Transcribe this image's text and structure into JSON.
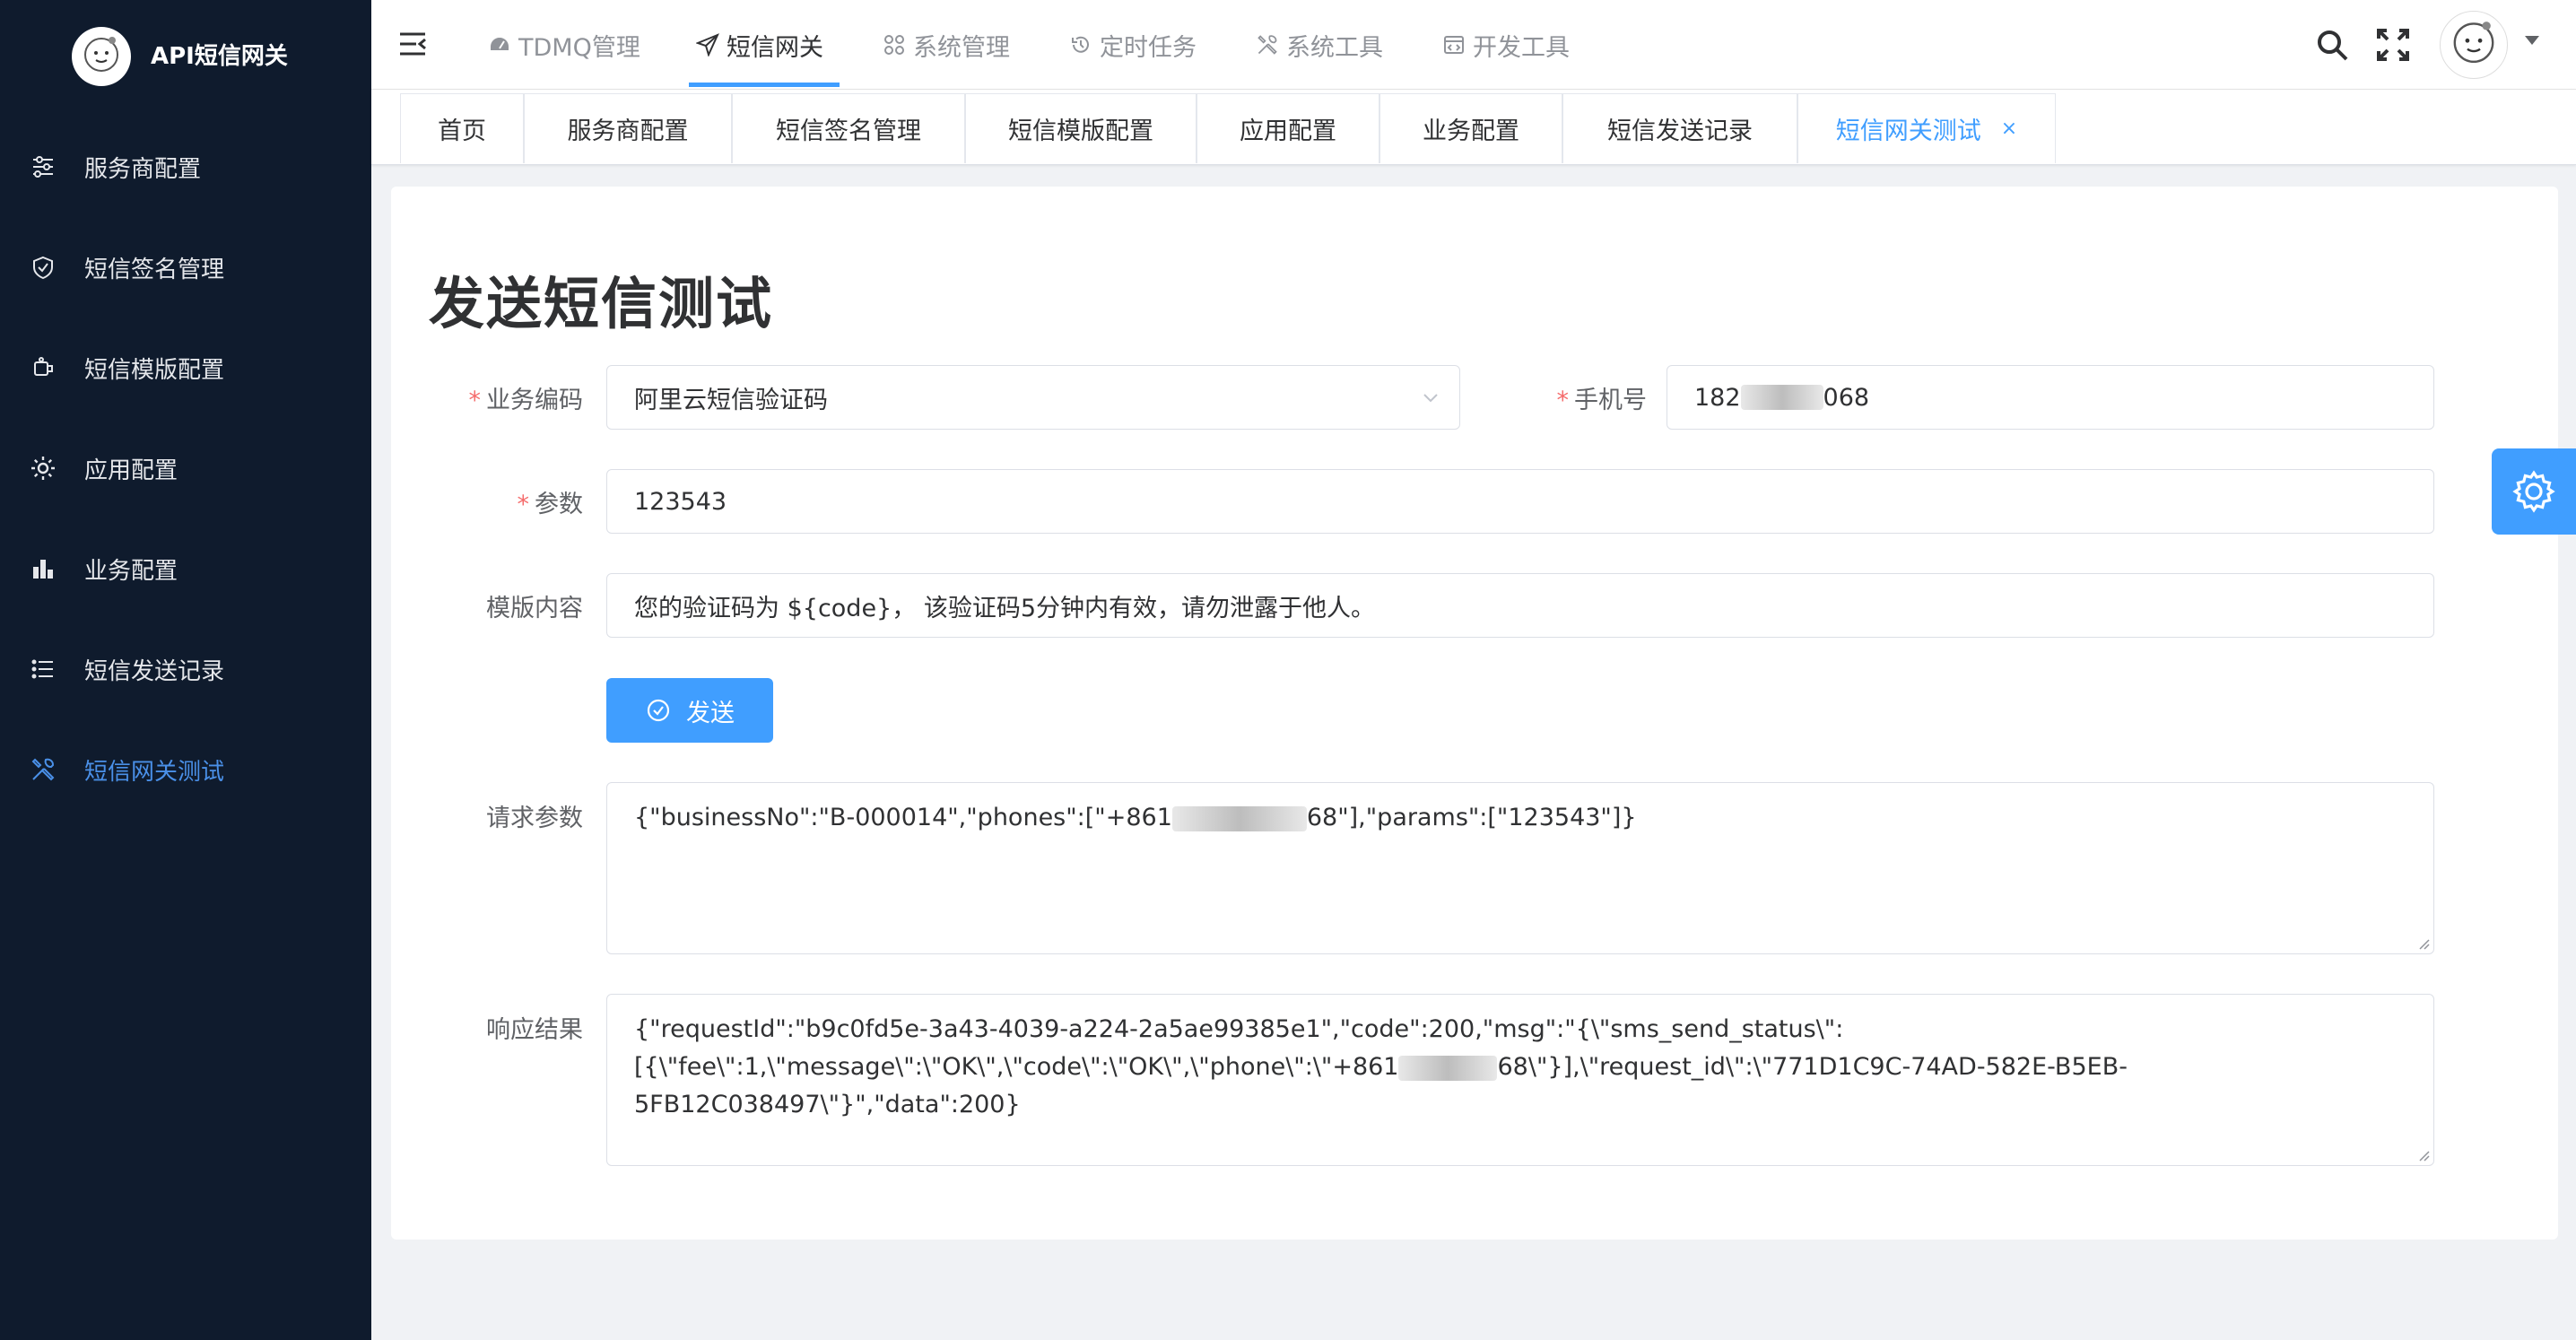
{
  "app": {
    "title": "API短信网关"
  },
  "sidebar": {
    "items": [
      {
        "label": "服务商配置",
        "icon": "sliders-icon",
        "active": false
      },
      {
        "label": "短信签名管理",
        "icon": "shield-check-icon",
        "active": false
      },
      {
        "label": "短信模版配置",
        "icon": "template-icon",
        "active": false
      },
      {
        "label": "应用配置",
        "icon": "gear-icon",
        "active": false
      },
      {
        "label": "业务配置",
        "icon": "bar-chart-icon",
        "active": false
      },
      {
        "label": "短信发送记录",
        "icon": "list-icon",
        "active": false
      },
      {
        "label": "短信网关测试",
        "icon": "tools-icon",
        "active": true
      }
    ]
  },
  "topnav": {
    "items": [
      {
        "label": "TDMQ管理",
        "icon": "dashboard-icon"
      },
      {
        "label": "短信网关",
        "icon": "send-icon"
      },
      {
        "label": "系统管理",
        "icon": "grid-icon"
      },
      {
        "label": "定时任务",
        "icon": "history-icon"
      },
      {
        "label": "系统工具",
        "icon": "tools-icon"
      },
      {
        "label": "开发工具",
        "icon": "code-window-icon"
      }
    ],
    "active_index": 1
  },
  "tags": {
    "items": [
      {
        "label": "首页"
      },
      {
        "label": "服务商配置"
      },
      {
        "label": "短信签名管理"
      },
      {
        "label": "短信模版配置"
      },
      {
        "label": "应用配置"
      },
      {
        "label": "业务配置"
      },
      {
        "label": "短信发送记录"
      },
      {
        "label": "短信网关测试",
        "close": "×"
      }
    ]
  },
  "form": {
    "title": "发送短信测试",
    "business_code": {
      "required_mark": "*",
      "label": "业务编码",
      "value": "阿里云短信验证码"
    },
    "phone": {
      "required_mark": "*",
      "label": "手机号",
      "value_prefix": "182",
      "value_suffix": "068"
    },
    "params": {
      "required_mark": "*",
      "label": "参数",
      "value": "123543"
    },
    "template_content": {
      "label": "模版内容",
      "value": "您的验证码为 ${code}， 该验证码5分钟内有效，请勿泄露于他人。"
    },
    "send_button": {
      "label": "发送"
    },
    "request_params": {
      "label": "请求参数",
      "value_prefix": "{\"businessNo\":\"B-000014\",\"phones\":[\"+861",
      "value_suffix": "68\"],\"params\":[\"123543\"]}"
    },
    "response": {
      "label": "响应结果",
      "line1": "{\"requestId\":\"b9c0fd5e-3a43-4039-a224-2a5ae99385e1\",\"code\":200,\"msg\":\"{\\\"sms_send_status\\\":",
      "line2_prefix": "[{\\\"fee\\\":1,\\\"message\\\":\\\"OK\\\",\\\"code\\\":\\\"OK\\\",\\\"phone\\\":\\\"+861",
      "line2_suffix": "68\\\"}],\\\"request_id\\\":\\\"771D1C9C-74AD-582E-B5EB-",
      "line3": "5FB12C038497\\\"}\",\"data\":200}"
    }
  },
  "colors": {
    "primary": "#409eff",
    "sidebar_bg": "#0f1b2d",
    "required": "#f56c6c"
  }
}
